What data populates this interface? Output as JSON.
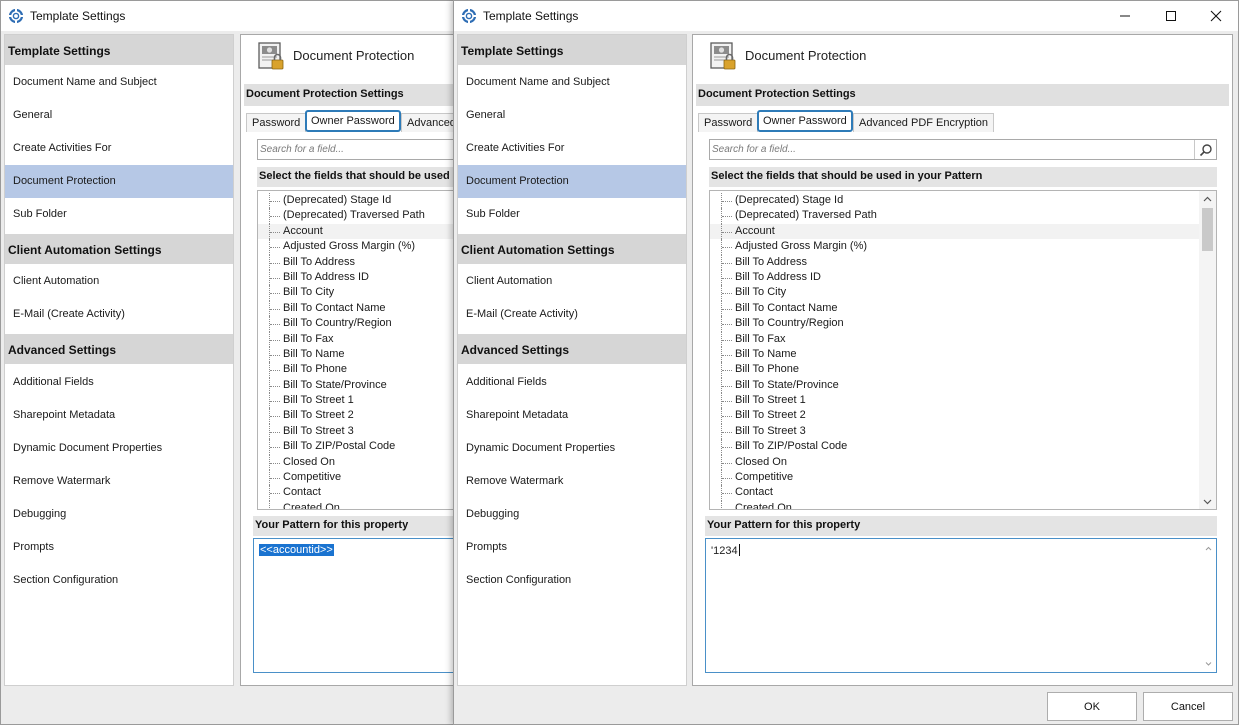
{
  "window_title": "Template Settings",
  "icons": {
    "app": "lifebuoy-icon",
    "document": "document-lock-icon",
    "search": "magnifier-icon",
    "minimize": "minimize-icon",
    "maximize": "maximize-icon",
    "close": "close-icon"
  },
  "sidebar": {
    "sections": [
      {
        "title": "Template Settings",
        "items": [
          "Document Name and Subject",
          "General",
          "Create Activities For",
          "Document Protection",
          "Sub Folder"
        ]
      },
      {
        "title": "Client Automation Settings",
        "items": [
          "Client Automation",
          "E-Mail (Create Activity)"
        ]
      },
      {
        "title": "Advanced Settings",
        "items": [
          "Additional Fields",
          "Sharepoint Metadata",
          "Dynamic Document Properties",
          "Remove Watermark",
          "Debugging",
          "Prompts",
          "Section Configuration"
        ]
      }
    ],
    "selected_item": "Document Protection"
  },
  "content": {
    "title": "Document Protection",
    "settings_header": "Document Protection Settings",
    "tabs": [
      "Password",
      "Owner Password",
      "Advanced PDF Encryption"
    ],
    "back_third_tab_visible": "Advanced",
    "active_tab": "Owner Password",
    "search_placeholder": "Search for a field...",
    "fields_header": "Select the fields that should be used in your Pattern",
    "back_fields_header_visible": "Select the fields that should be used in",
    "fields": [
      "(Deprecated) Stage Id",
      "(Deprecated) Traversed Path",
      "Account",
      "Adjusted Gross Margin (%)",
      "Bill To Address",
      "Bill To Address ID",
      "Bill To City",
      "Bill To Contact Name",
      "Bill To Country/Region",
      "Bill To Fax",
      "Bill To Name",
      "Bill To Phone",
      "Bill To State/Province",
      "Bill To Street 1",
      "Bill To Street 2",
      "Bill To Street 3",
      "Bill To ZIP/Postal Code",
      "Closed On",
      "Competitive",
      "Contact",
      "Created On"
    ],
    "highlighted_field": "Account",
    "pattern_header": "Your Pattern for this property"
  },
  "back_window": {
    "pattern_value": "<<accountid>>"
  },
  "front_window": {
    "pattern_value": "'1234"
  },
  "buttons": {
    "ok": "OK",
    "cancel": "Cancel"
  },
  "colors": {
    "selected_item": "#b6c8e6",
    "active_tab_border": "#2e7bb8",
    "section_header": "#d6d6d6",
    "text_selection": "#1a73d0"
  }
}
